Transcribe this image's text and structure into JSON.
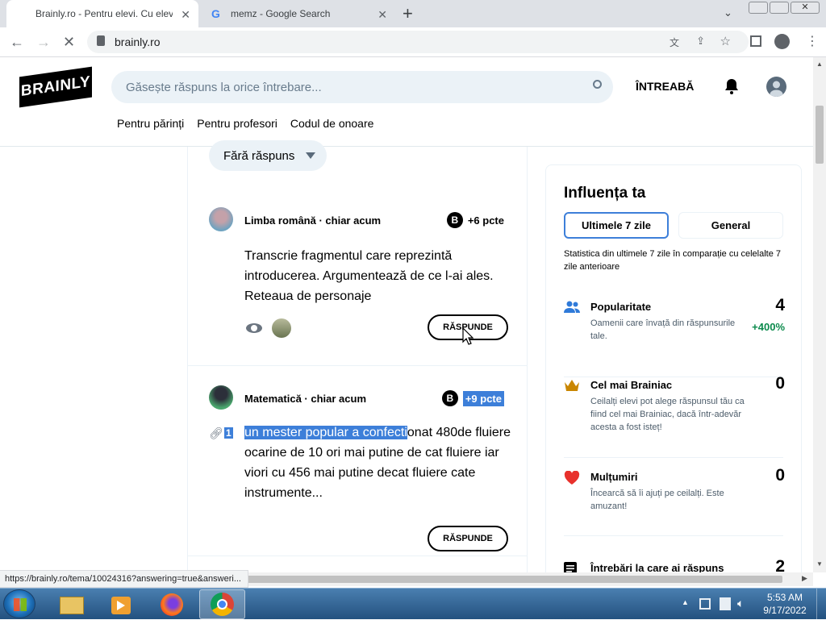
{
  "browser": {
    "tabs": [
      {
        "title": "Brainly.ro - Pentru elevi. Cu elevi.",
        "active": true
      },
      {
        "title": "memz - Google Search",
        "active": false
      }
    ],
    "new_tab_label": "+",
    "url": "brainly.ro"
  },
  "site": {
    "logo_text": "BRAINLY",
    "search_placeholder": "Găsește răspuns la orice întrebare...",
    "ask_label": "ÎNTREABĂ",
    "nav": [
      "Pentru părinți",
      "Pentru profesori",
      "Codul de onoare"
    ],
    "filter_label": "Fără răspuns"
  },
  "questions": [
    {
      "subject": "Limba română",
      "time": "chiar acum",
      "points": "+6 pcte",
      "text": "Transcrie fragmentul care reprezintă introducerea. Argumentează de ce l-ai ales. Reteaua de personaje",
      "answer_label": "RĂSPUNDE"
    },
    {
      "subject": "Matematică",
      "time": "chiar acum",
      "points": "+9 pcte",
      "attachment_count": "1",
      "text_highlighted": "un mester popular a confecti",
      "text_rest": "onat 480de fluiere ocarine de 10 ori mai putine de cat fluiere iar viori cu 456 mai putine decat fluiere cate instrumente...",
      "answer_label": "RĂSPUNDE"
    }
  ],
  "influence": {
    "title": "Influența ta",
    "tab_week": "Ultimele 7 zile",
    "tab_general": "General",
    "description": "Statistica din ultimele 7 zile în comparație cu celelalte 7 zile anterioare",
    "stats": [
      {
        "icon": "people-icon",
        "name": "Popularitate",
        "value": "4",
        "desc": "Oamenii care învață din răspunsurile tale.",
        "change": "+400%"
      },
      {
        "icon": "crown-icon",
        "name": "Cel mai Brainiac",
        "value": "0",
        "desc": "Ceilalți elevi pot alege răspunsul tău ca fiind cel mai Brainiac, dacă într-adevăr acesta a fost isteț!"
      },
      {
        "icon": "heart-icon",
        "name": "Mulțumiri",
        "value": "0",
        "desc": "Încearcă să îi ajuți pe ceilalți. Este amuzant!"
      },
      {
        "icon": "list-icon",
        "name": "Întrebări la care ai răspuns",
        "value": "2"
      }
    ]
  },
  "status_url": "https://brainly.ro/tema/10024316?answering=true&answeri...",
  "taskbar": {
    "time": "5:53 AM",
    "date": "9/17/2022"
  },
  "colors": {
    "accent": "#3d7fd9",
    "green": "#0b8a4c",
    "heart": "#e8312c",
    "crown": "#c98600",
    "people": "#2f7ad9"
  }
}
